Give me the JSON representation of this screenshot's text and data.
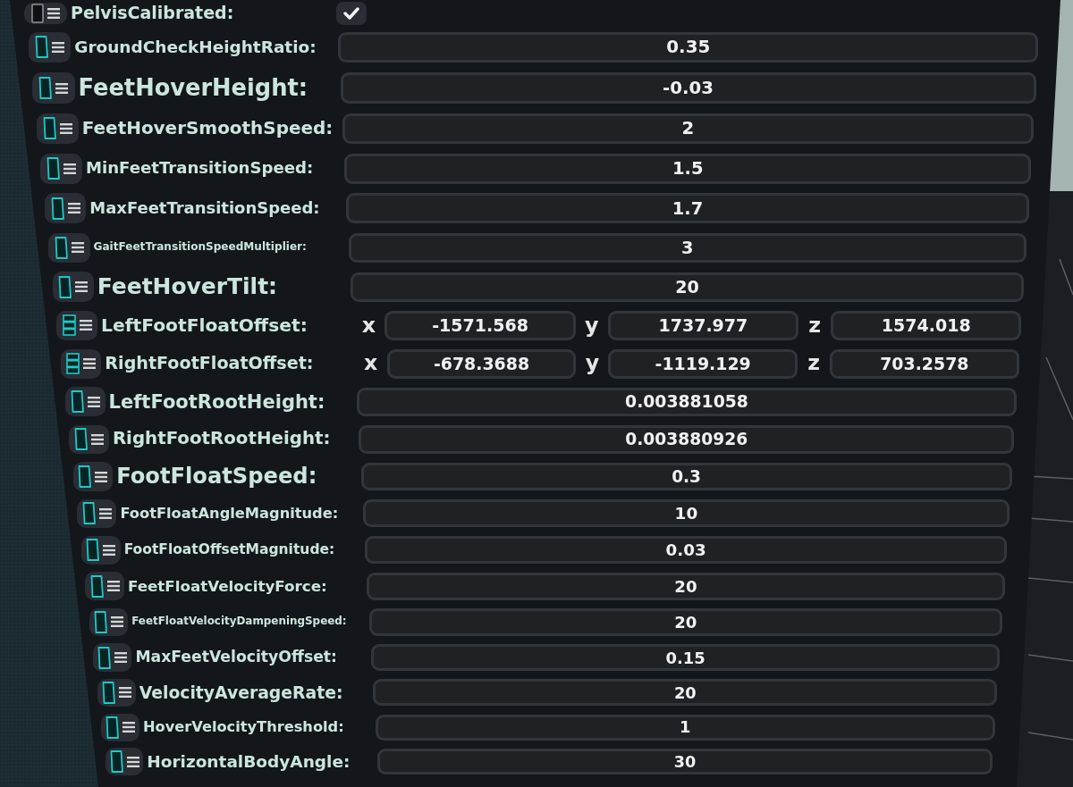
{
  "fields": [
    {
      "kind": "bool",
      "label": "PelvisCalibrated:",
      "checked": true
    },
    {
      "kind": "float",
      "label": "GroundCheckHeightRatio:",
      "value": "0.35"
    },
    {
      "kind": "float",
      "label": "FeetHoverHeight:",
      "value": "-0.03"
    },
    {
      "kind": "float",
      "label": "FeetHoverSmoothSpeed:",
      "value": "2"
    },
    {
      "kind": "float",
      "label": "MinFeetTransitionSpeed:",
      "value": "1.5"
    },
    {
      "kind": "float",
      "label": "MaxFeetTransitionSpeed:",
      "value": "1.7"
    },
    {
      "kind": "float",
      "label": "GaitFeetTransitionSpeedMultiplier:",
      "value": "3"
    },
    {
      "kind": "float",
      "label": "FeetHoverTilt:",
      "value": "20"
    },
    {
      "kind": "vector",
      "label": "LeftFootFloatOffset:",
      "components": [
        {
          "axis": "x",
          "value": "-1571.568"
        },
        {
          "axis": "y",
          "value": "1737.977"
        },
        {
          "axis": "z",
          "value": "1574.018"
        }
      ]
    },
    {
      "kind": "vector",
      "label": "RightFootFloatOffset:",
      "components": [
        {
          "axis": "x",
          "value": "-678.3688"
        },
        {
          "axis": "y",
          "value": "-1119.129"
        },
        {
          "axis": "z",
          "value": "703.2578"
        }
      ]
    },
    {
      "kind": "float",
      "label": "LeftFootRootHeight:",
      "value": "0.003881058"
    },
    {
      "kind": "float",
      "label": "RightFootRootHeight:",
      "value": "0.003880926"
    },
    {
      "kind": "float",
      "label": "FootFloatSpeed:",
      "value": "0.3"
    },
    {
      "kind": "float",
      "label": "FootFloatAngleMagnitude:",
      "value": "10"
    },
    {
      "kind": "float",
      "label": "FootFloatOffsetMagnitude:",
      "value": "0.03"
    },
    {
      "kind": "float",
      "label": "FeetFloatVelocityForce:",
      "value": "20"
    },
    {
      "kind": "float",
      "label": "FeetFloatVelocityDampeningSpeed:",
      "value": "20"
    },
    {
      "kind": "float",
      "label": "MaxFeetVelocityOffset:",
      "value": "0.15"
    },
    {
      "kind": "float",
      "label": "VelocityAverageRate:",
      "value": "20"
    },
    {
      "kind": "float",
      "label": "HoverVelocityThreshold:",
      "value": "1"
    },
    {
      "kind": "float",
      "label": "HorizontalBodyAngle:",
      "value": "30"
    }
  ]
}
